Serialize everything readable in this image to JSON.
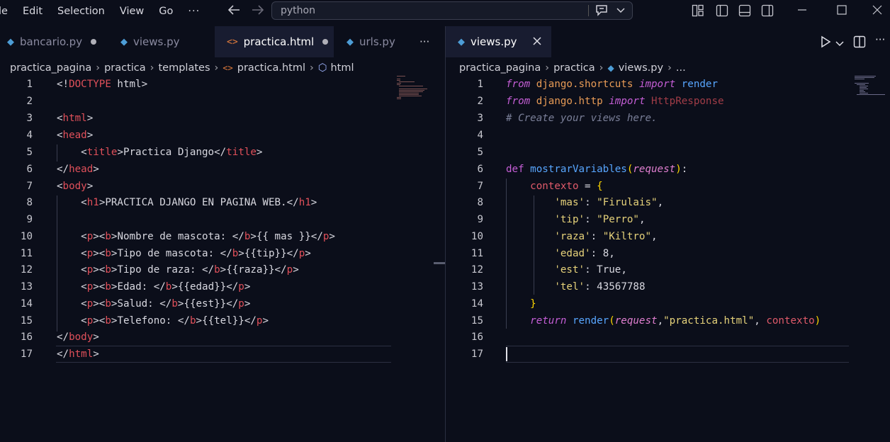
{
  "menu": {
    "items": [
      "le",
      "Edit",
      "Selection",
      "View",
      "Go"
    ],
    "more": "···"
  },
  "command_center": {
    "value": "python"
  },
  "left": {
    "tabs": [
      {
        "label": "bancario.py",
        "icon": "python-file-icon",
        "dirty": true
      },
      {
        "label": "views.py",
        "icon": "python-file-icon",
        "dirty": false
      },
      {
        "label": "practica.html",
        "icon": "html-file-icon",
        "dirty": true,
        "active": true
      },
      {
        "label": "urls.py",
        "icon": "python-file-icon",
        "dirty": false
      }
    ],
    "more": "···",
    "breadcrumb": {
      "parts": [
        "practica_pagina",
        "practica",
        "templates",
        "practica.html",
        "html"
      ]
    },
    "line_numbers": [
      "1",
      "2",
      "3",
      "4",
      "5",
      "6",
      "7",
      "8",
      "9",
      "10",
      "11",
      "12",
      "13",
      "14",
      "15",
      "16",
      "17"
    ]
  },
  "right": {
    "tabs": [
      {
        "label": "views.py",
        "icon": "python-file-icon",
        "active": true
      }
    ],
    "breadcrumb": {
      "parts": [
        "practica_pagina",
        "practica",
        "views.py",
        "..."
      ]
    },
    "line_numbers": [
      "1",
      "2",
      "3",
      "4",
      "5",
      "6",
      "7",
      "8",
      "9",
      "10",
      "11",
      "12",
      "13",
      "14",
      "15",
      "16",
      "17"
    ]
  },
  "colors": {
    "tag": "#e0505a",
    "keyword": "#c55ed6",
    "module": "#e89b56",
    "function": "#58a6ff",
    "string": "#e6d27a",
    "comment": "#7a7f98",
    "background": "#0b0e1a"
  }
}
